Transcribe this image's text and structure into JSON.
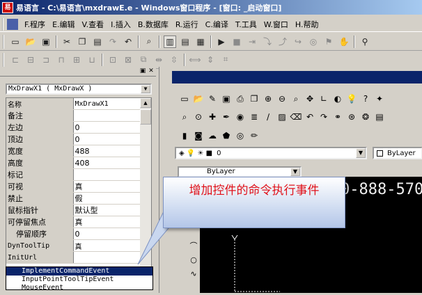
{
  "window": {
    "title": "易语言 - C:\\易语言\\mxdrawE.e - Windows窗口程序 - [窗口: _启动窗口]",
    "app_icon": "易"
  },
  "menu": [
    "F.程序",
    "E.编辑",
    "V.查看",
    "I.插入",
    "B.数据库",
    "R.运行",
    "C.编译",
    "T.工具",
    "W.窗口",
    "H.帮助"
  ],
  "toolbar_icons": [
    "new-icon",
    "open-icon",
    "save-icon",
    "cut-icon",
    "copy-icon",
    "paste-icon",
    "redo-icon",
    "undo-icon",
    "find-icon",
    "layout1-icon",
    "layout2-icon",
    "layout3-icon",
    "run-icon",
    "stop-icon",
    "step-icon",
    "debug-icon",
    "binoculars-icon"
  ],
  "properties": {
    "object_combo": "MxDrawX1 ( MxDrawX )",
    "rows": [
      {
        "name": "名称",
        "value": "MxDrawX1",
        "mono": true
      },
      {
        "name": "备注",
        "value": ""
      },
      {
        "name": "左边",
        "value": "0"
      },
      {
        "name": "顶边",
        "value": "0"
      },
      {
        "name": "宽度",
        "value": "488"
      },
      {
        "name": "高度",
        "value": "408"
      },
      {
        "name": "标记",
        "value": ""
      },
      {
        "name": "可视",
        "value": "真"
      },
      {
        "name": "禁止",
        "value": "假"
      },
      {
        "name": "鼠标指针",
        "value": "默认型"
      },
      {
        "name": "可停留焦点",
        "value": "真"
      },
      {
        "name": "停留顺序",
        "value": "0",
        "indent": true
      },
      {
        "name": "DynToolTip",
        "value": "真",
        "mono": true
      },
      {
        "name": "InitUrl",
        "value": "",
        "mono": true
      }
    ],
    "events_dropdown": [
      "ImplementCommandEvent",
      "InputPointToolTipEvent",
      "MouseEvent"
    ],
    "selected_event_index": 0
  },
  "cad": {
    "layer_value": "0",
    "color_value": "ByLayer",
    "linetype_value": "ByLayer",
    "canvas_text": "0-888-570"
  },
  "callout": {
    "text": "增加控件的命令执行事件"
  }
}
